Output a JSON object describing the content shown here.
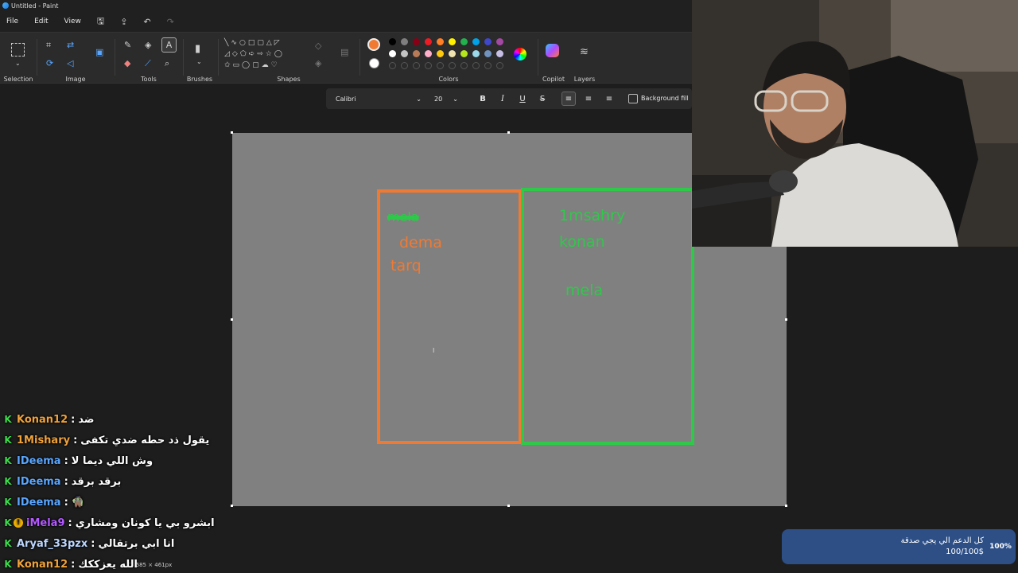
{
  "window": {
    "title": "Untitled - Paint"
  },
  "menu": {
    "file": "File",
    "edit": "Edit",
    "view": "View"
  },
  "ribbon": {
    "groups": {
      "selection": "Selection",
      "image": "Image",
      "tools": "Tools",
      "brushes": "Brushes",
      "shapes": "Shapes",
      "colors": "Colors",
      "copilot": "Copilot",
      "layers": "Layers"
    },
    "current_color": "#f07a32",
    "palette_row1": [
      "#000000",
      "#7f7f7f",
      "#880015",
      "#ed1c24",
      "#ff7f27",
      "#fff200",
      "#22b14c",
      "#00a2e8",
      "#3f48cc",
      "#a349a4"
    ],
    "palette_row2": [
      "#ffffff",
      "#c3c3c3",
      "#b97a57",
      "#ffaec9",
      "#ffc90e",
      "#efe4b0",
      "#b5e61d",
      "#99d9ea",
      "#7092be",
      "#c8bfe7"
    ]
  },
  "textbar": {
    "font": "Calibri",
    "size": "20",
    "bold": "B",
    "italic": "I",
    "underline": "U",
    "strike": "S",
    "background_fill": "Background fill"
  },
  "canvas": {
    "background": "#808080",
    "left_box_color": "#f07a32",
    "right_box_color": "#2fc84a",
    "left_names": [
      "dema",
      "tarq"
    ],
    "scribbled_name": "mela",
    "right_names": [
      "1msahry",
      "konan",
      "mela"
    ],
    "cursor": "I"
  },
  "statusbar": {
    "dimensions": "685 × 461px"
  },
  "chat": [
    {
      "user": "Konan12",
      "color": "#f0a23a",
      "message": "ضد"
    },
    {
      "user": "1Mishary",
      "color": "#f0a23a",
      "message": "يقول ذد حطه ضدي تكفى"
    },
    {
      "user": "IDeema",
      "color": "#5aa6ff",
      "message": "وش اللي ديما لا"
    },
    {
      "user": "IDeema",
      "color": "#5aa6ff",
      "message": "برقد برقد"
    },
    {
      "user": "IDeema",
      "color": "#5aa6ff",
      "message": "🧌"
    },
    {
      "user": "iMela9",
      "color": "#b45aff",
      "message": "ابشرو بي يا كونان ومشاري",
      "badge2": true
    },
    {
      "user": "Aryaf_33pzx",
      "color": "#bcd6ff",
      "message": "انا ابي برتقالي"
    },
    {
      "user": "Konan12",
      "color": "#f0a23a",
      "message": "الله يعزككك"
    }
  ],
  "donation": {
    "title": "كل الدعم الي يجي صدقة",
    "amount": "100/100$",
    "percent": "100%",
    "progress": 1.0
  }
}
